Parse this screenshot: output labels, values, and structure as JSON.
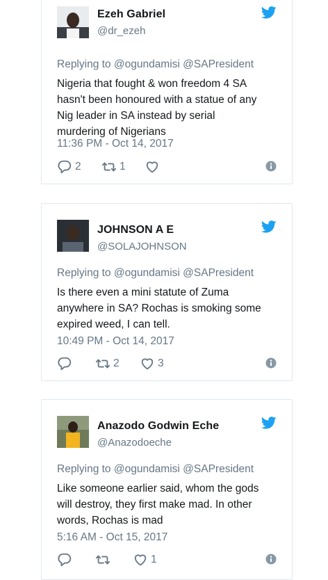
{
  "colors": {
    "accent": "#1da1f2",
    "muted": "#657786",
    "text": "#14171a",
    "border": "#e1e8ed"
  },
  "tweets": [
    {
      "name": "Ezeh Gabriel",
      "handle": "@dr_ezeh",
      "replying": "Replying to @ogundamisi @SAPresident",
      "lines": [
        "Nigeria that fought & won freedom 4 SA",
        "hasn't been honoured with a statue of any",
        "Nig leader in SA instead by serial",
        "murdering of Nigerians"
      ],
      "time": "11:36 PM - Oct 14, 2017",
      "reply_count": "2",
      "retweet_count": "1",
      "like_count": ""
    },
    {
      "name": "JOHNSON A E",
      "handle": "@SOLAJOHNSON",
      "replying": "Replying to @ogundamisi @SAPresident",
      "lines": [
        "Is there even a mini statute of Zuma",
        "anywhere in SA? Rochas is smoking some",
        "expired weed, I can tell."
      ],
      "time": "10:49 PM - Oct 14, 2017",
      "reply_count": "",
      "retweet_count": "2",
      "like_count": "3"
    },
    {
      "name": "Anazodo Godwin Eche",
      "handle": "@Anazodoeche",
      "replying": "Replying to @ogundamisi @SAPresident",
      "lines": [
        "Like someone earlier said, whom the gods",
        "will destroy, they first make mad. In other",
        "words, Rochas is mad"
      ],
      "time": "5:16 AM - Oct 15, 2017",
      "reply_count": "",
      "retweet_count": "",
      "like_count": "1"
    }
  ],
  "icons": {
    "reply": "reply-icon",
    "retweet": "retweet-icon",
    "like": "heart-icon",
    "info": "info-icon",
    "brand": "twitter-bird-icon"
  }
}
